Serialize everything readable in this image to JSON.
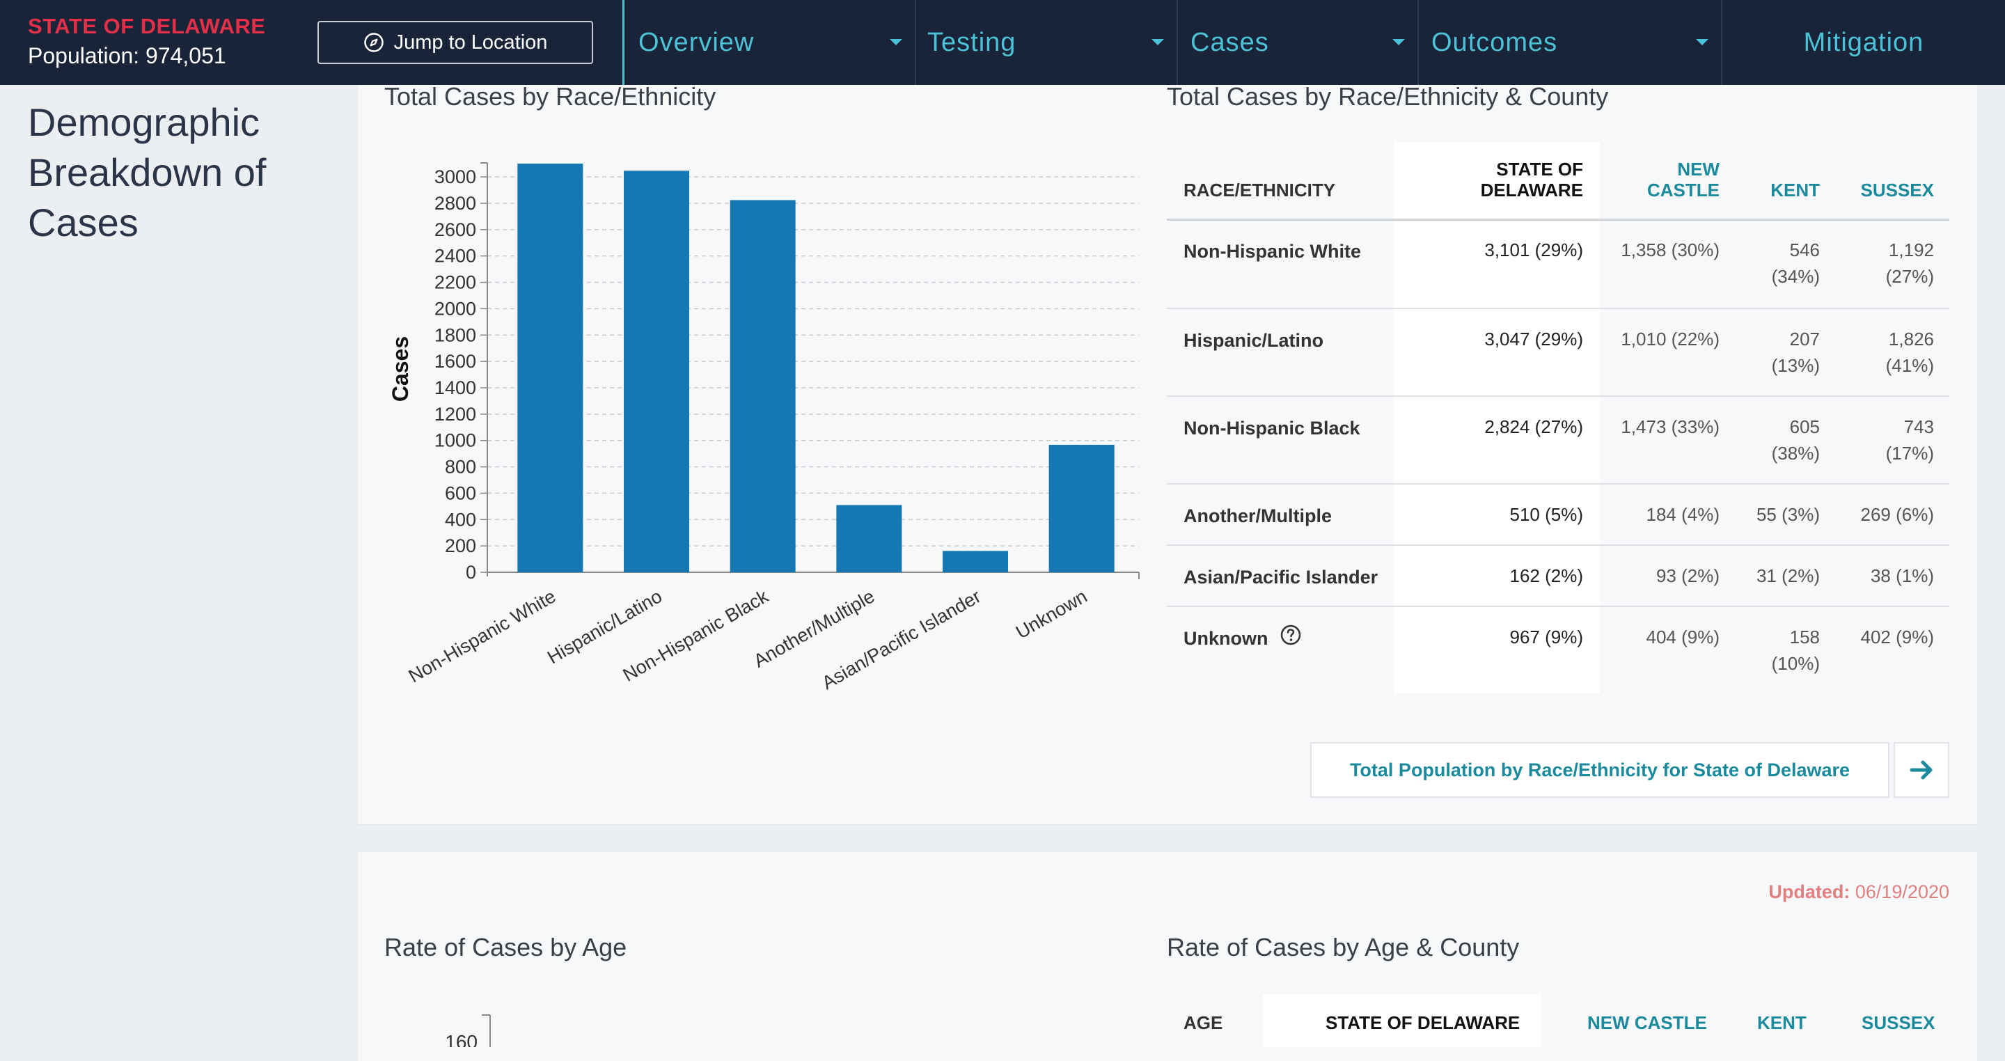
{
  "header": {
    "state": "STATE OF DELAWARE",
    "population": "Population: 974,051",
    "jump_label": "Jump to Location",
    "nav": [
      "Overview",
      "Testing",
      "Cases",
      "Outcomes",
      "Mitigation"
    ]
  },
  "section_title": "Demographic Breakdown of Cases",
  "race_card": {
    "chart_title": "Total Cases by Race/Ethnicity",
    "table_title": "Total Cases by Race/Ethnicity & County",
    "table": {
      "headers": {
        "col0": "RACE/ETHNICITY",
        "state_line1": "STATE OF",
        "state_line2": "DELAWARE",
        "nc_line1": "NEW",
        "nc_line2": "CASTLE",
        "kent": "KENT",
        "sussex": "SUSSEX"
      },
      "rows": [
        {
          "label": "Non-Hispanic White",
          "state": "3,101 (29%)",
          "nc": "1,358 (30%)",
          "kent1": "546",
          "kent2": "(34%)",
          "sussex1": "1,192",
          "sussex2": "(27%)"
        },
        {
          "label": "Hispanic/Latino",
          "state": "3,047 (29%)",
          "nc": "1,010 (22%)",
          "kent1": "207",
          "kent2": "(13%)",
          "sussex1": "1,826",
          "sussex2": "(41%)"
        },
        {
          "label": "Non-Hispanic Black",
          "state": "2,824 (27%)",
          "nc": "1,473 (33%)",
          "kent1": "605",
          "kent2": "(38%)",
          "sussex1": "743",
          "sussex2": "(17%)"
        },
        {
          "label": "Another/Multiple",
          "state": "510 (5%)",
          "nc": "184 (4%)",
          "kent1": "55 (3%)",
          "kent2": "",
          "sussex1": "269 (6%)",
          "sussex2": ""
        },
        {
          "label": "Asian/Pacific Islander",
          "state": "162 (2%)",
          "nc": "93 (2%)",
          "kent1": "31 (2%)",
          "kent2": "",
          "sussex1": "38 (1%)",
          "sussex2": ""
        },
        {
          "label": "Unknown",
          "state": "967 (9%)",
          "nc": "404 (9%)",
          "kent1": "158",
          "kent2": "(10%)",
          "sussex1": "402 (9%)",
          "sussex2": ""
        }
      ]
    },
    "pop_button": "Total Population by Race/Ethnicity for State of Delaware"
  },
  "age_card": {
    "updated_label": "Updated:",
    "updated_date": "06/19/2020",
    "chart_title": "Rate of Cases by Age",
    "table_title": "Rate of Cases by Age & County",
    "headers": {
      "age": "AGE",
      "state": "STATE OF DELAWARE",
      "nc": "NEW CASTLE",
      "kent": "KENT",
      "sussex": "SUSSEX"
    },
    "partial_tick": "160"
  },
  "colors": {
    "nav_bg": "#1a2438",
    "accent": "#4cc2d8",
    "bar": "#1677b5",
    "teal": "#1a8a9c",
    "red": "#e32f48"
  },
  "chart_data": {
    "type": "bar",
    "title": "",
    "xlabel": "",
    "ylabel": "Cases",
    "categories": [
      "Non-Hispanic White",
      "Hispanic/Latino",
      "Non-Hispanic Black",
      "Another/Multiple",
      "Asian/Pacific Islander",
      "Unknown"
    ],
    "values": [
      3101,
      3047,
      2824,
      510,
      162,
      967
    ],
    "yticks": [
      0,
      200,
      400,
      600,
      800,
      1000,
      1200,
      1400,
      1600,
      1800,
      2000,
      2200,
      2400,
      2600,
      2800,
      3000
    ],
    "ylim": [
      0,
      3400
    ],
    "grid": true
  }
}
